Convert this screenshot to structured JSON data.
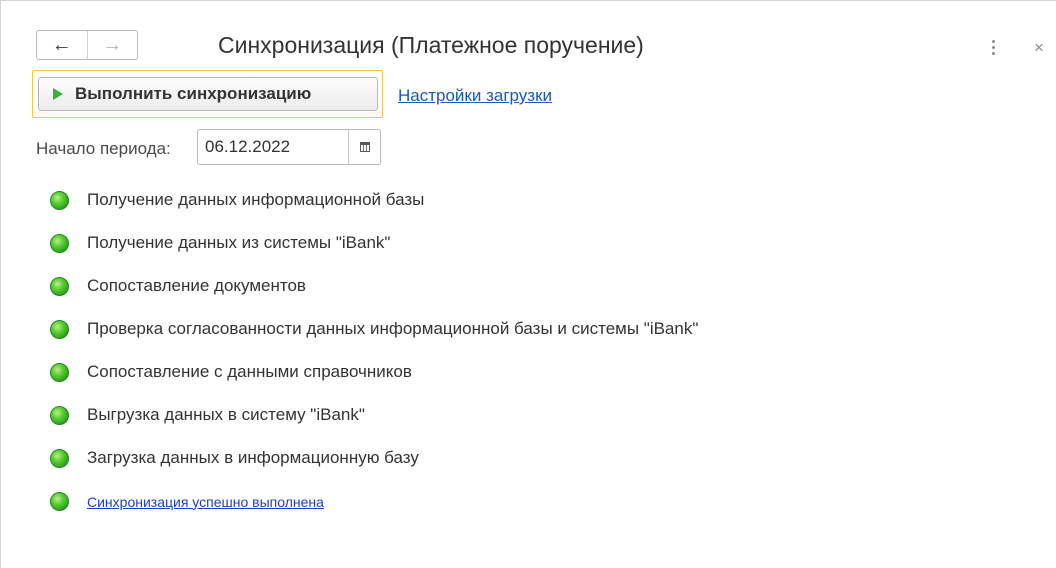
{
  "window": {
    "title": "Синхронизация (Платежное поручение)",
    "nav": {
      "back_icon": "arrow-left-icon",
      "forward_icon": "arrow-right-icon"
    },
    "more_icon": "more-vertical-icon",
    "close_icon": "close-icon"
  },
  "toolbar": {
    "run_label": "Выполнить синхронизацию",
    "settings_link": "Настройки загрузки"
  },
  "period": {
    "label": "Начало периода:",
    "value": "06.12.2022"
  },
  "steps": [
    {
      "label": "Получение данных информационной базы",
      "status": "ok"
    },
    {
      "label": "Получение данных из системы \"iBank\"",
      "status": "ok"
    },
    {
      "label": "Сопоставление документов",
      "status": "ok"
    },
    {
      "label": "Проверка согласованности данных информационной базы и системы \"iBank\"",
      "status": "ok"
    },
    {
      "label": "Сопоставление с данными справочников",
      "status": "ok"
    },
    {
      "label": "Выгрузка данных в систему \"iBank\"",
      "status": "ok"
    },
    {
      "label": "Загрузка данных в информационную базу",
      "status": "ok"
    }
  ],
  "result": {
    "label": "Синхронизация успешно выполнена",
    "status": "ok"
  },
  "colors": {
    "accent_link": "#1a56c8",
    "success": "#3bae3b",
    "focus": "#f2c84b"
  }
}
